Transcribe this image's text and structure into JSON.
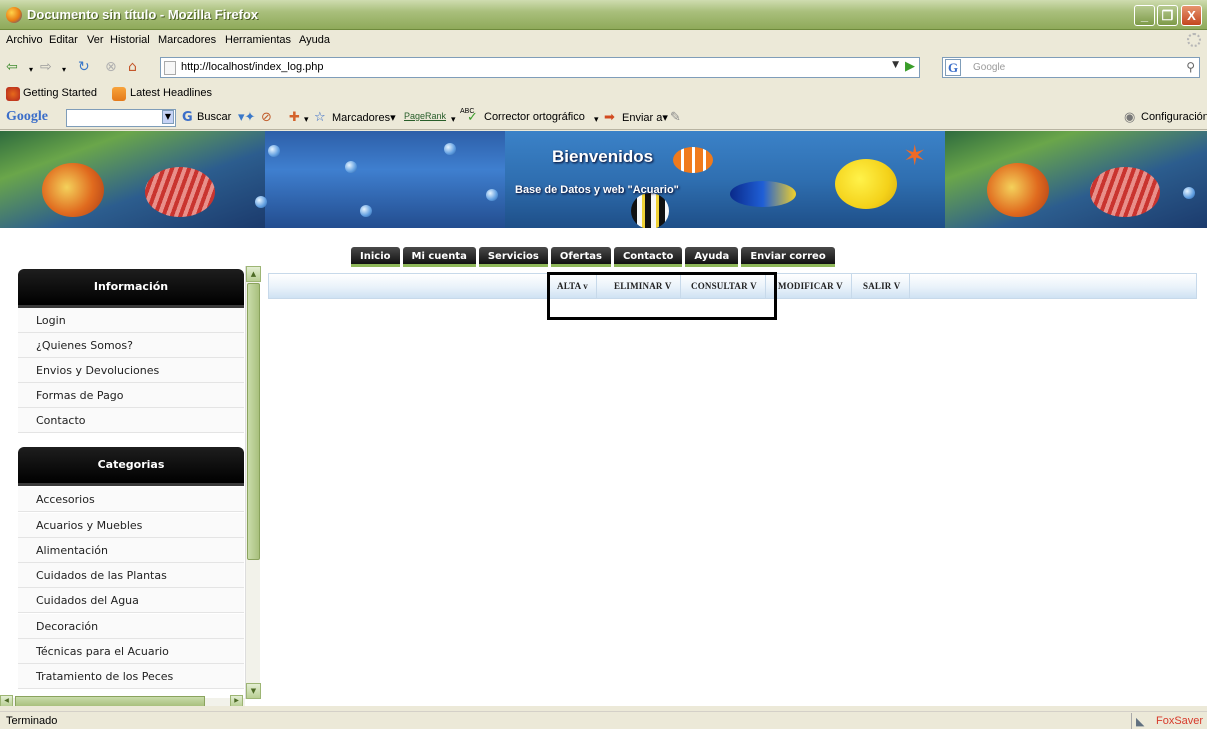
{
  "window": {
    "title": "Documento sin título - Mozilla Firefox",
    "buttons": [
      "_",
      "❐",
      "X"
    ]
  },
  "menubar": {
    "items": [
      "Archivo",
      "Editar",
      "Ver",
      "Historial",
      "Marcadores",
      "Herramientas",
      "Ayuda"
    ]
  },
  "navbar": {
    "url": "http://localhost/index_log.php",
    "search_placeholder": "Google",
    "search_engine": "G"
  },
  "bookmarks": {
    "items": [
      "Getting Started",
      "Latest Headlines"
    ]
  },
  "google_toolbar": {
    "logo": "Google",
    "buscar": "Buscar",
    "marcadores": "Marcadores",
    "pagerank": "PageRank",
    "abc": "ABC",
    "corrector": "Corrector ortográfico",
    "enviar": "Enviar a",
    "configuracion": "Configuración"
  },
  "banner": {
    "welcome": "Bienvenidos",
    "subtitle": "Base de Datos y web \"Acuario\""
  },
  "tabs": [
    "Inicio",
    "Mi cuenta",
    "Servicios",
    "Ofertas",
    "Contacto",
    "Ayuda",
    "Enviar correo"
  ],
  "sidebar": {
    "info_title": "Información",
    "info_items": [
      "Login",
      "¿Quienes Somos?",
      "Envios y Devoluciones",
      "Formas de Pago",
      "Contacto"
    ],
    "cat_title": "Categorias",
    "cat_items": [
      "Accesorios",
      "Acuarios y Muebles",
      "Alimentación",
      "Cuidados de las Plantas",
      "Cuidados del Agua",
      "Decoración",
      "Técnicas para el Acuario",
      "Tratamiento de los Peces"
    ]
  },
  "submenu": {
    "items": [
      "ALTA v",
      "ELIMINAR V",
      "CONSULTAR V",
      "MODIFICAR V",
      "SALIR V"
    ]
  },
  "status": {
    "text": "Terminado",
    "addon": "FoxSaver"
  },
  "colors": {
    "titlebar": "#8faa5a",
    "tab_bg": "#111111",
    "tab_accent": "#8fb85a",
    "submenu_bg": "#e9f2fa"
  }
}
